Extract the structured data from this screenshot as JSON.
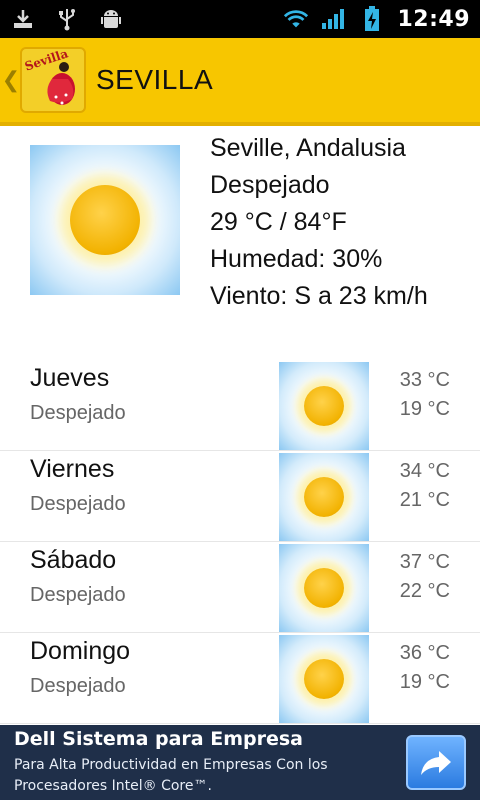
{
  "status_bar": {
    "time": "12:49",
    "left_icons": [
      "download-icon",
      "usb-icon",
      "android-icon"
    ],
    "right_icons": [
      "wifi-icon",
      "signal-icon",
      "battery-charging-icon"
    ]
  },
  "app_header": {
    "title": "SEVILLA",
    "logo_text": "Sevilla",
    "colors": {
      "background": "#f7c600"
    }
  },
  "current": {
    "location": "Seville, Andalusia",
    "condition": "Despejado",
    "temperature": "29 °C / 84°F",
    "humidity": "Humedad: 30%",
    "wind": "Viento: S a 23 km/h",
    "icon": "sunny-icon"
  },
  "forecast": [
    {
      "day": "Jueves",
      "condition": "Despejado",
      "high": "33 °C",
      "low": "19 °C",
      "icon": "sunny-icon"
    },
    {
      "day": "Viernes",
      "condition": "Despejado",
      "high": "34 °C",
      "low": "21 °C",
      "icon": "sunny-icon"
    },
    {
      "day": "Sábado",
      "condition": "Despejado",
      "high": "37 °C",
      "low": "22 °C",
      "icon": "sunny-icon"
    },
    {
      "day": "Domingo",
      "condition": "Despejado",
      "high": "36 °C",
      "low": "19 °C",
      "icon": "sunny-icon"
    }
  ],
  "ad": {
    "title": "Dell Sistema para Empresa",
    "text": "Para Alta Productividad en Empresas Con los Procesadores Intel® Core™.",
    "button_icon": "share-arrow-icon",
    "colors": {
      "background": "#1f2f49"
    }
  }
}
